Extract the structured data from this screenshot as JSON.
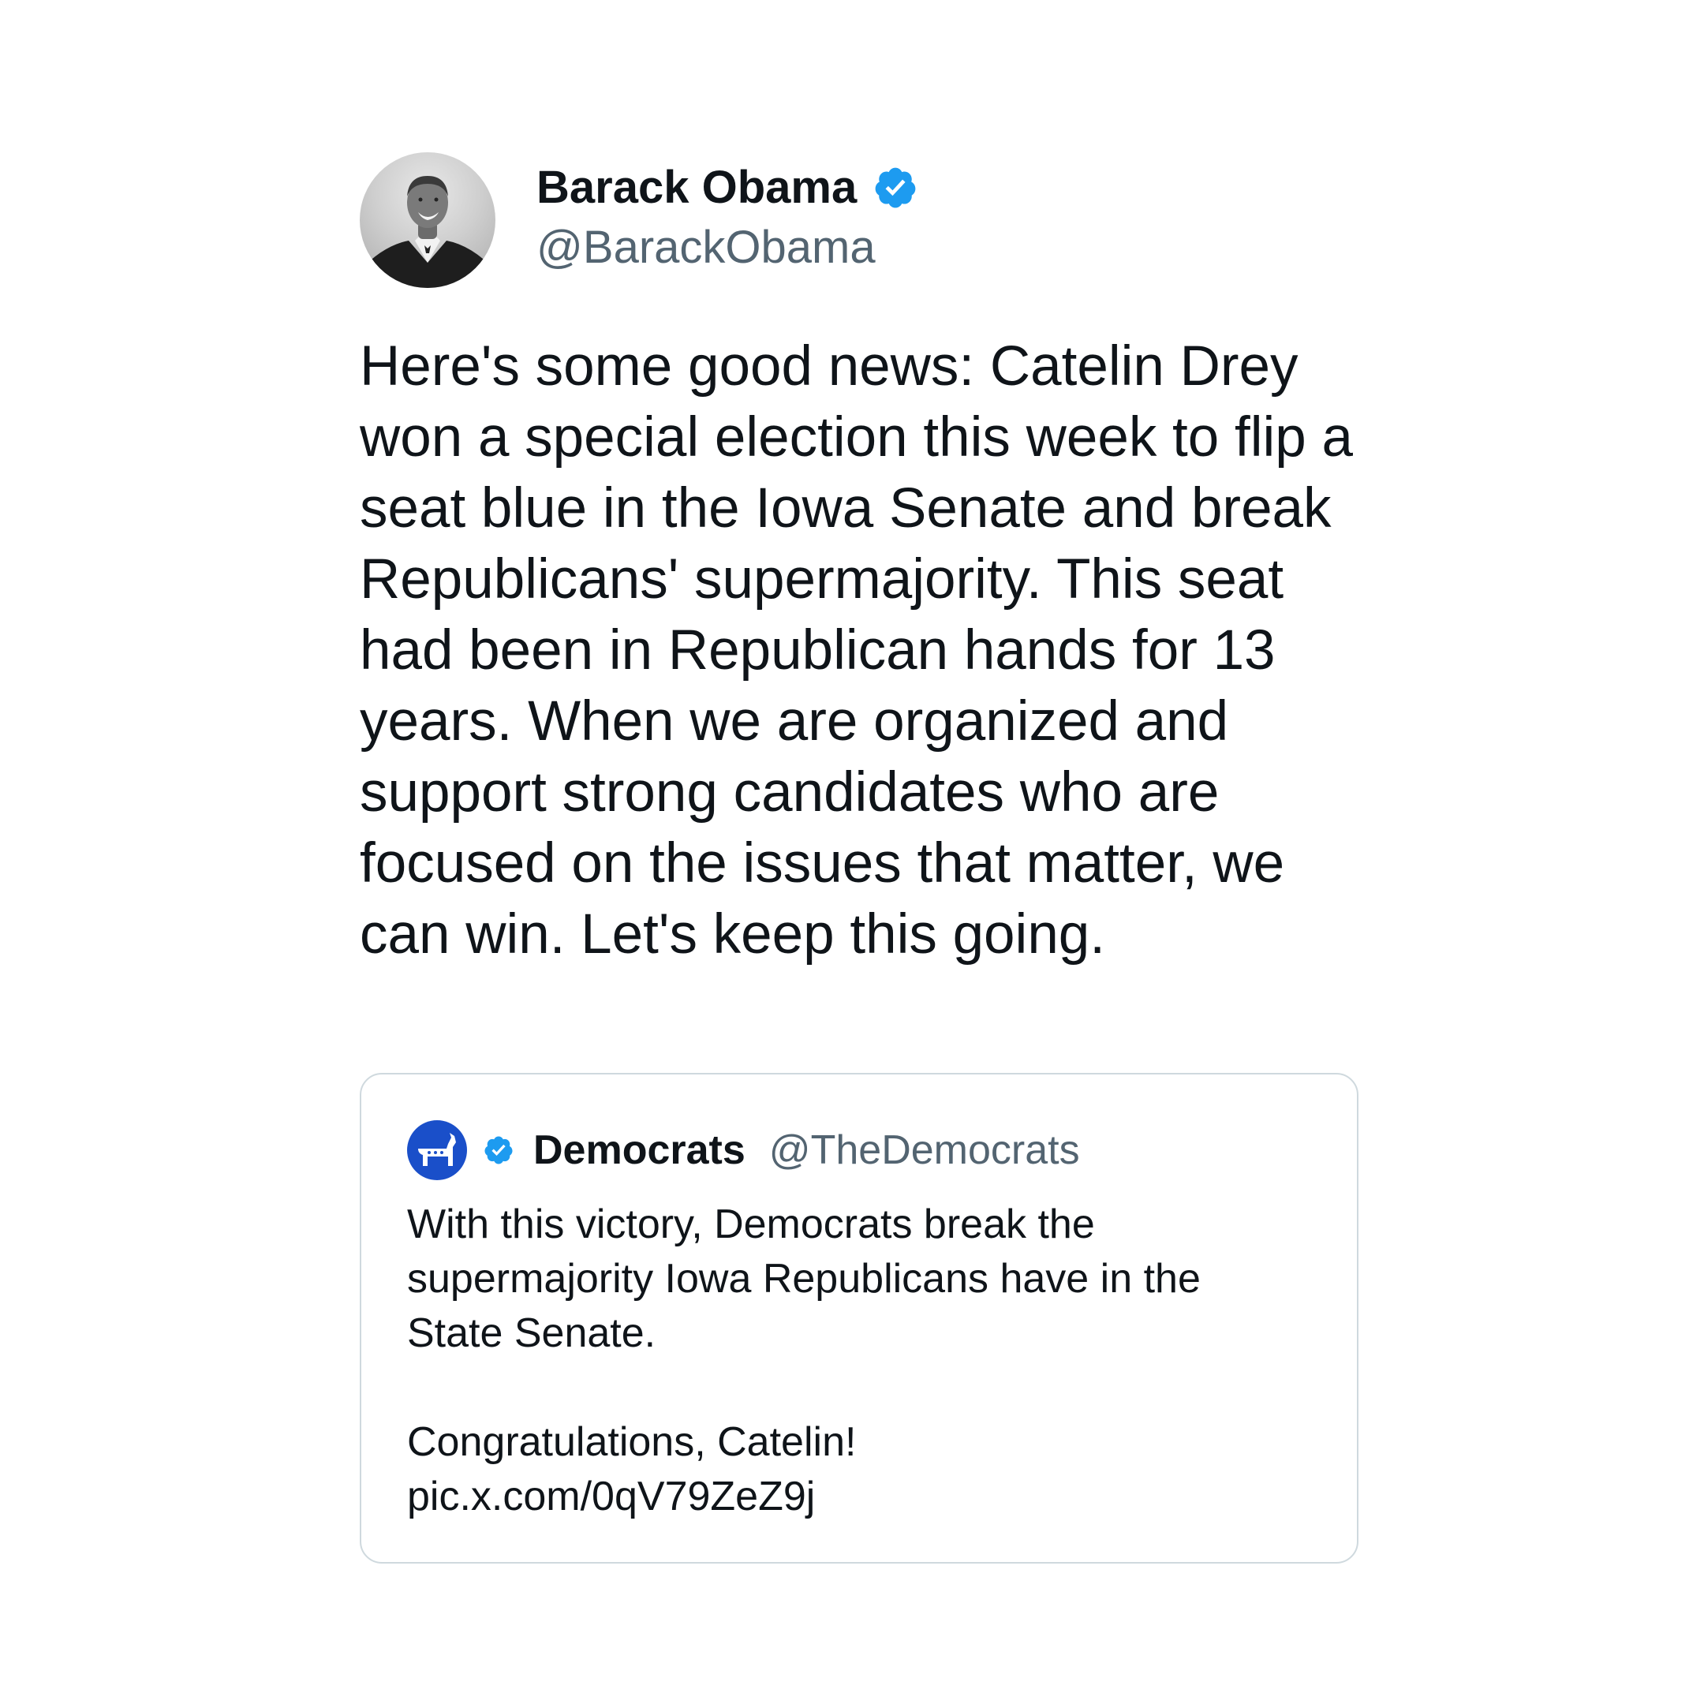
{
  "colors": {
    "verified_blue": "#1d9bf0",
    "handle_gray": "#536471",
    "text": "#0f1419",
    "card_border": "#cfd9de",
    "democrats_blue": "#1a4fc9"
  },
  "tweet": {
    "author": {
      "display_name": "Barack Obama",
      "handle": "@BarackObama",
      "verified_icon": "verified-badge-icon",
      "avatar_icon": "profile-photo"
    },
    "text": "Here's some good news: Catelin Drey won a special election this week to flip a seat blue in the Iowa Senate and break Republicans' supermajority. This seat had been in Republican hands for 13 years. When we are organized and support strong candidates who are focused on the issues that matter, we can win. Let's keep this going."
  },
  "quoted_tweet": {
    "author": {
      "display_name": "Democrats",
      "handle": "@TheDemocrats",
      "verified_icon": "verified-badge-icon",
      "avatar_icon": "donkey-logo-icon"
    },
    "text": "With this victory, Democrats break the\nsupermajority Iowa Republicans have in the\nState Senate.\n\nCongratulations, Catelin!\npic.x.com/0qV79ZeZ9j"
  }
}
